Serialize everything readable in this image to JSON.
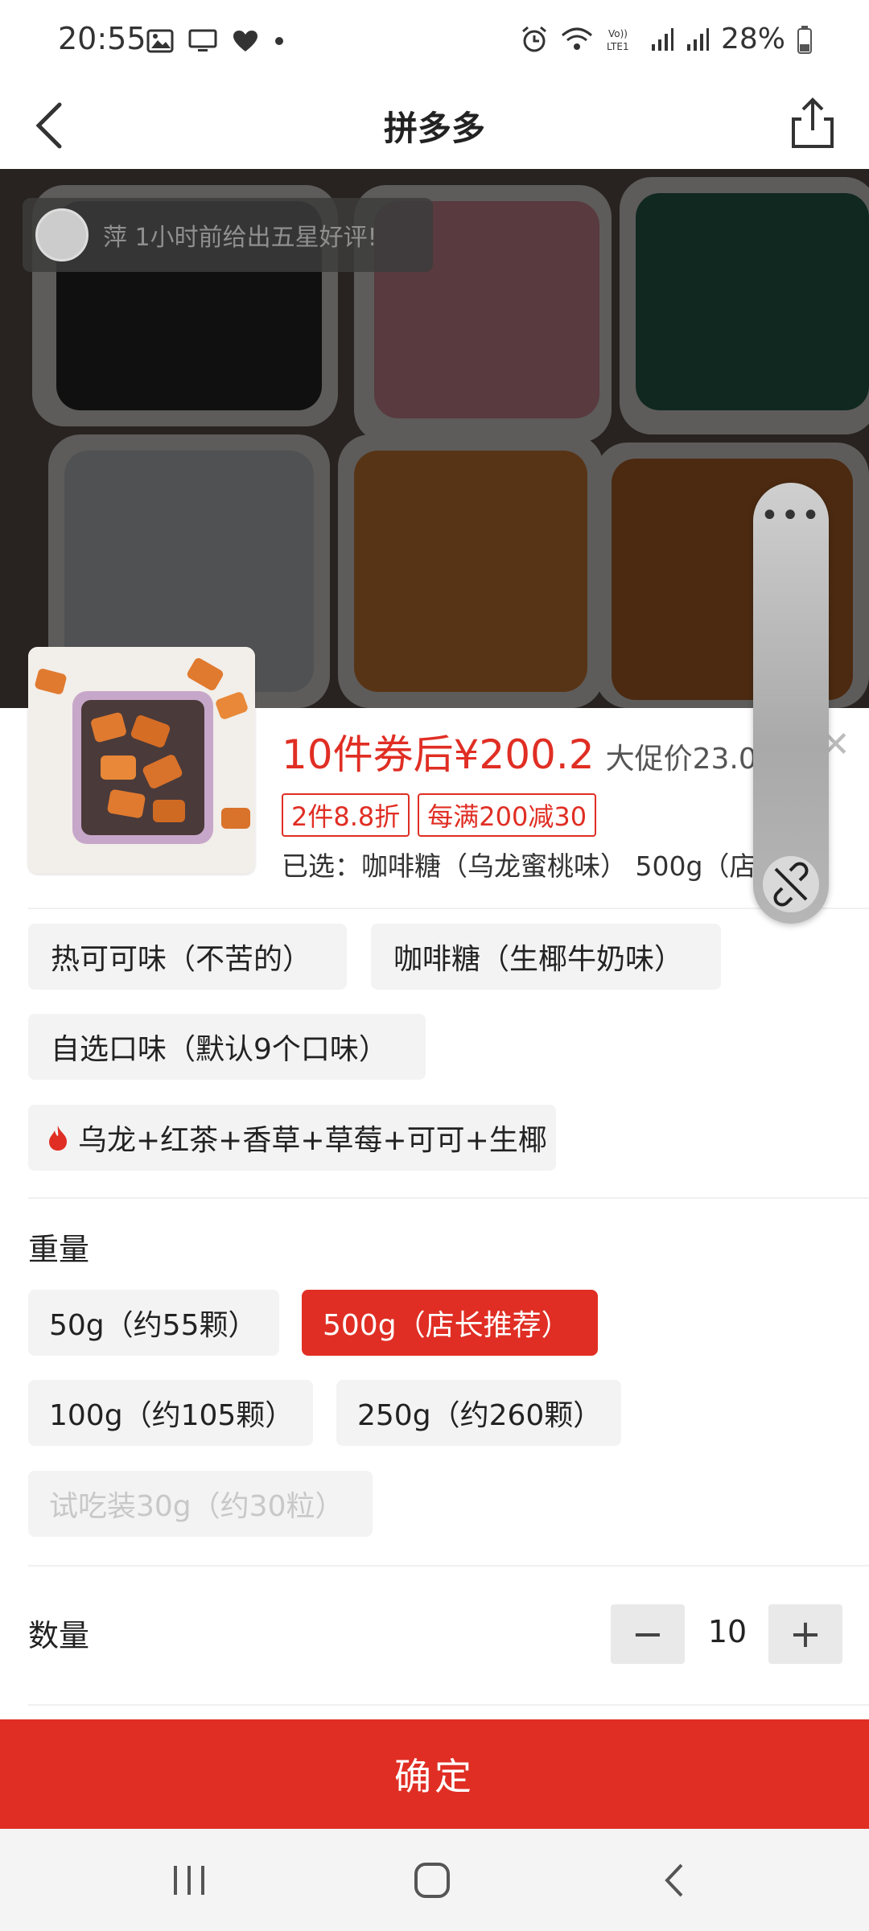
{
  "status_bar": {
    "time": "20:55",
    "battery": "28%"
  },
  "header": {
    "title": "拼多多"
  },
  "review_toast": {
    "text": "萍 1小时前给出五星好评!"
  },
  "price": {
    "main": "10件券后¥200.2",
    "sub": "大促价23.02"
  },
  "tags": [
    "2件8.8折",
    "每满200减30"
  ],
  "selected": "已选：咖啡糖（乌龙蜜桃味） 500g（店...",
  "flavor_options": [
    {
      "label": "热可可味（不苦的）"
    },
    {
      "label": "咖啡糖（生椰牛奶味）"
    },
    {
      "label": "自选口味（默认9个口味）"
    },
    {
      "label": "乌龙+红茶+香草+草莓+可可+生椰"
    }
  ],
  "weight": {
    "label": "重量",
    "options": [
      {
        "label": "50g（约55颗）",
        "state": "normal"
      },
      {
        "label": "500g（店长推荐）",
        "state": "selected"
      },
      {
        "label": "100g（约105颗）",
        "state": "normal"
      },
      {
        "label": "250g（约260颗）",
        "state": "normal"
      },
      {
        "label": "试吃装30g（约30粒）",
        "state": "disabled"
      }
    ]
  },
  "quantity": {
    "label": "数量",
    "value": "10",
    "minus": "−",
    "plus": "+"
  },
  "confirm_button": "确定",
  "floating_widget": {
    "dots": "•••"
  },
  "colors": {
    "accent": "#e02e24",
    "chip_bg": "#f3f3f3"
  }
}
